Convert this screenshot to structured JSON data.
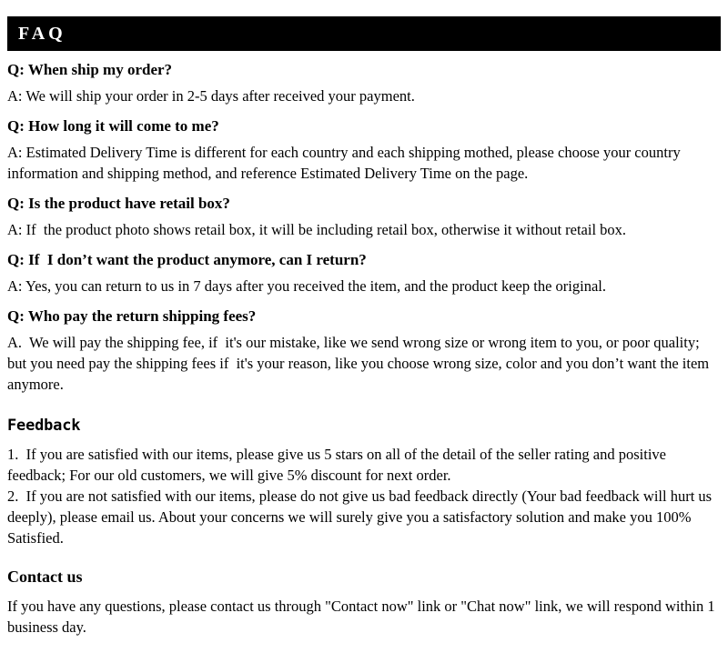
{
  "header": {
    "title": "FAQ"
  },
  "faq": {
    "items": [
      {
        "question": "Q: When ship my order?",
        "answer": "A: We will ship your order in 2-5 days after received your payment."
      },
      {
        "question": "Q: How long it will come to me?",
        "answer": "A: Estimated Delivery Time is different for each country and each shipping mothed, please choose your country information and shipping method, and reference Estimated Delivery Time on the page."
      },
      {
        "question": "Q: Is the product have retail box?",
        "answer": "A: If  the product photo shows retail box, it will be including retail box, otherwise it without retail box."
      },
      {
        "question": "Q: If  I don’t want the product anymore, can I return?",
        "answer": "A: Yes, you can return to us in 7 days after you received the item, and the product keep the original."
      },
      {
        "question": "Q: Who pay the return shipping fees?",
        "answer": "A.  We will pay the shipping fee, if  it's our mistake, like we send wrong size or wrong item to you, or poor quality; but you need pay the shipping fees if  it's your reason, like you choose wrong size, color and you don’t want the item anymore."
      }
    ]
  },
  "feedback": {
    "heading": "Feedback",
    "item1": "1.  If you are satisfied with our items, please give us 5 stars on all of the detail of the seller rating and positive feedback; For our old customers, we will give 5% discount for next order.",
    "item2": "2.  If you are not satisfied with our items, please do not give us bad feedback directly (Your bad feedback will hurt us deeply), please email us. About your concerns we will surely give you a satisfactory solution and make you 100% Satisfied."
  },
  "contact": {
    "heading": "Contact us",
    "body": "If you have any questions, please contact us through \"Contact now\" link or \"Chat now\" link, we will respond within 1 business day."
  },
  "colors": {
    "header_background": "#000000",
    "header_text": "#ffffff",
    "page_background": "#ffffff",
    "body_text": "#000000"
  }
}
